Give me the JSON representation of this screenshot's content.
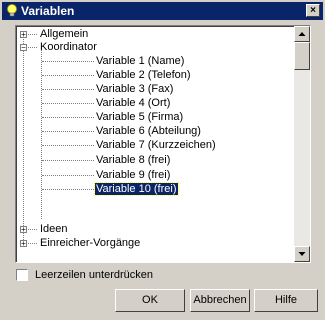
{
  "window": {
    "title": "Variablen",
    "close_label": "×"
  },
  "tree": {
    "nodes": [
      {
        "label": "Allgemein",
        "toggle": "+"
      },
      {
        "label": "Koordinator",
        "toggle": "−"
      },
      {
        "label": "Variable 1 (Name)"
      },
      {
        "label": "Variable 2 (Telefon)"
      },
      {
        "label": "Variable 3 (Fax)"
      },
      {
        "label": "Variable 4 (Ort)"
      },
      {
        "label": "Variable 5 (Firma)"
      },
      {
        "label": "Variable 6 (Abteilung)"
      },
      {
        "label": "Variable 7 (Kurzzeichen)"
      },
      {
        "label": "Variable 8 (frei)"
      },
      {
        "label": "Variable 9 (frei)"
      },
      {
        "label": "Variable 10 (frei)",
        "selected": true
      },
      {
        "label": "Ideen",
        "toggle": "+"
      },
      {
        "label": "Einreicher-Vorgänge",
        "toggle": "+"
      }
    ]
  },
  "options": {
    "suppress_empty_lines_label": "Leerzeilen unterdrücken",
    "suppress_empty_lines_checked": false
  },
  "buttons": {
    "ok": "OK",
    "cancel": "Abbrechen",
    "help": "Hilfe"
  }
}
